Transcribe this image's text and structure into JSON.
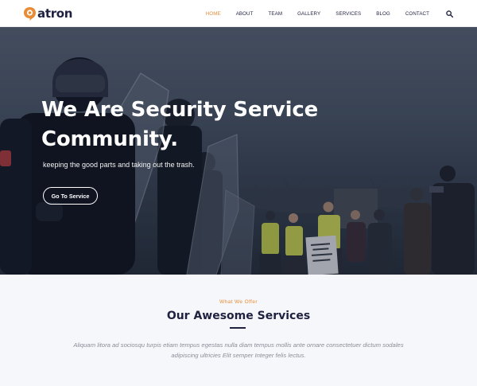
{
  "header": {
    "logo_text": "atron",
    "brand_color": "#e88c37",
    "nav": [
      {
        "label": "HOME",
        "active": true
      },
      {
        "label": "ABOUT",
        "active": false
      },
      {
        "label": "TEAM",
        "active": false
      },
      {
        "label": "GALLERY",
        "active": false
      },
      {
        "label": "SERVICES",
        "active": false
      },
      {
        "label": "BLOG",
        "active": false
      },
      {
        "label": "CONTACT",
        "active": false
      }
    ],
    "search_icon": "search-icon"
  },
  "hero": {
    "title_line1": "We Are Security Service",
    "title_line2": "Community.",
    "tagline": "keeping the good parts and taking out the trash.",
    "button_label": "Go To Service",
    "sign_lines": [
      "Stop",
      "the",
      "police",
      "violence"
    ]
  },
  "services": {
    "eyebrow": "What We Offer",
    "title": "Our Awesome Services",
    "description": "Aliquam litora ad sociosqu turpis etiam tempus egestas nulla diam tempus mollis ante ornare consectetuer dictum sodales adipiscing ultricies Elit semper Integer felis lectus."
  }
}
